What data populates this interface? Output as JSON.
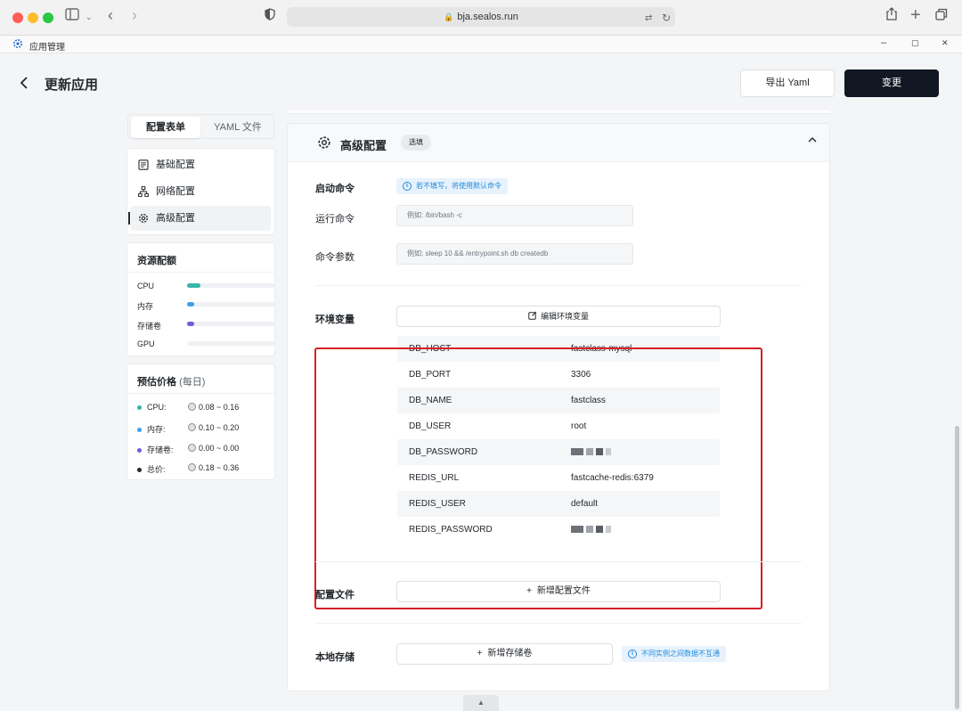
{
  "browser": {
    "url": "bja.sealos.run",
    "traffic_lights": [
      "#ff5f57",
      "#febc2e",
      "#28c840"
    ]
  },
  "app": {
    "title": "应用管理",
    "window_controls": [
      "–",
      "▢",
      "✕"
    ]
  },
  "header": {
    "back_icon": "‹",
    "title": "更新应用",
    "export_label": "导出 Yaml",
    "change_label": "变更"
  },
  "tabs": [
    {
      "label": "配置表单",
      "active": true
    },
    {
      "label": "YAML 文件",
      "active": false
    }
  ],
  "side_nav": [
    {
      "label": "基础配置",
      "icon": "document-icon"
    },
    {
      "label": "网络配置",
      "icon": "network-icon"
    },
    {
      "label": "高级配置",
      "icon": "gear-icon",
      "active": true
    }
  ],
  "resources": {
    "title": "资源配额",
    "items": [
      {
        "label": "CPU",
        "fill": 0.15,
        "color": "#36b5aa"
      },
      {
        "label": "内存",
        "fill": 0.08,
        "color": "#3d9ee8"
      },
      {
        "label": "存储卷",
        "fill": 0.08,
        "color": "#6f5dd7"
      },
      {
        "label": "GPU",
        "fill": 0,
        "color": "#9aa0a6"
      }
    ]
  },
  "pricing": {
    "title": "预估价格",
    "subtitle": "(每日)",
    "items": [
      {
        "label": "CPU:",
        "value": "0.08 ~ 0.16",
        "color": "#36b5aa"
      },
      {
        "label": "内存:",
        "value": "0.10 ~ 0.20",
        "color": "#3d9ee8"
      },
      {
        "label": "存储卷:",
        "value": "0.00 ~ 0.00",
        "color": "#6f5dd7"
      },
      {
        "label": "总价:",
        "value": "0.18 ~ 0.36",
        "color": "#24282c"
      }
    ]
  },
  "advanced": {
    "title": "高级配置",
    "badge": "选填",
    "startup_label": "启动命令",
    "startup_hint": "若不填写，将使用默认命令",
    "run_cmd_label": "运行命令",
    "run_cmd_placeholder": "例如: /bin/bash -c",
    "args_label": "命令参数",
    "args_placeholder": "例如: sleep 10 && /entrypoint.sh db createdb",
    "env_label": "环境变量",
    "edit_env_label": "编辑环境变量",
    "env_vars": [
      {
        "key": "DB_HOST",
        "value": "fastclass-mysql"
      },
      {
        "key": "DB_PORT",
        "value": "3306"
      },
      {
        "key": "DB_NAME",
        "value": "fastclass"
      },
      {
        "key": "DB_USER",
        "value": "root"
      },
      {
        "key": "DB_PASSWORD",
        "value": "",
        "masked": true
      },
      {
        "key": "REDIS_URL",
        "value": "fastcache-redis:6379"
      },
      {
        "key": "REDIS_USER",
        "value": "default"
      },
      {
        "key": "REDIS_PASSWORD",
        "value": "",
        "masked": true
      }
    ],
    "config_file_label": "配置文件",
    "add_config_label": "新增配置文件",
    "storage_label": "本地存储",
    "add_storage_label": "新增存储卷",
    "storage_hint": "不同实例之间数据不互通"
  },
  "colors": {
    "highlight": "#d42028",
    "primary_dark": "#111824",
    "hint_blue": "#1d8cdc"
  }
}
